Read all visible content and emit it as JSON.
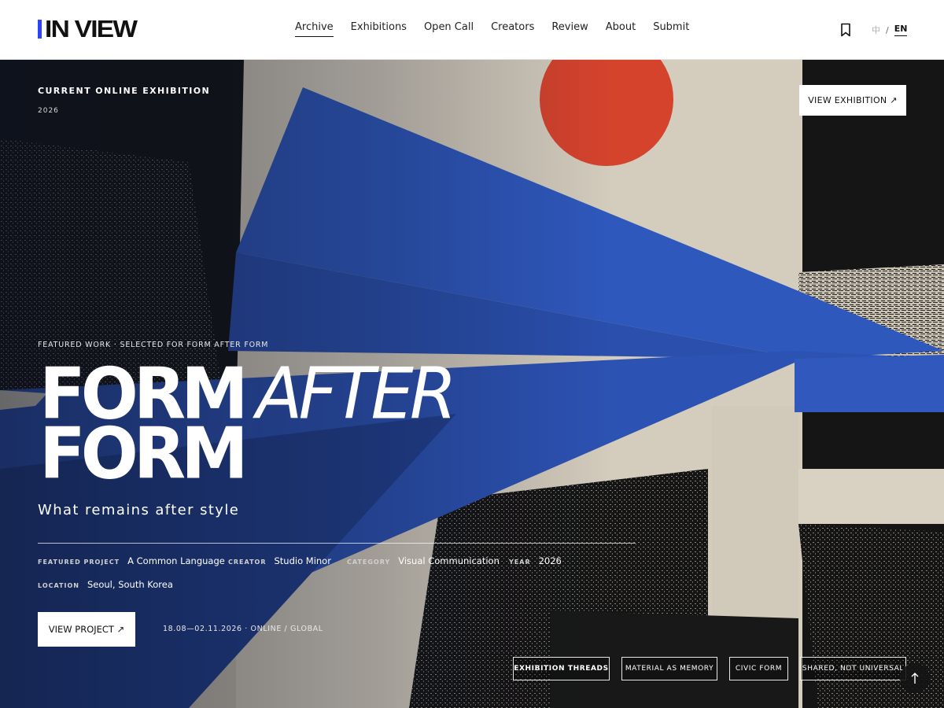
{
  "header": {
    "logo_text": "IN VIEW",
    "logo_accent_color": "#2f43ff",
    "nav": [
      {
        "label": "Archive",
        "active": true
      },
      {
        "label": "Exhibitions"
      },
      {
        "label": "Open Call"
      },
      {
        "label": "Creators"
      },
      {
        "label": "Review"
      },
      {
        "label": "About"
      },
      {
        "label": "Submit"
      }
    ],
    "bookmark_icon": "bookmark-icon",
    "lang": {
      "zh": "中",
      "sep": "/",
      "en": "EN"
    }
  },
  "hero": {
    "eyebrow": "CURRENT ONLINE EXHIBITION",
    "year": "2026",
    "view_exhibition_label": "VIEW EXHIBITION ↗",
    "featured_label": "FEATURED WORK · SELECTED FOR FORM AFTER FORM",
    "title_word1": "FORM",
    "title_word2": "AFTER",
    "title_word3": "FORM",
    "subtitle": "What remains after style",
    "meta": {
      "project_key": "FEATURED PROJECT",
      "project_val": "A Common Language",
      "creator_key": "CREATOR",
      "creator_val": "Studio Minor",
      "category_key": "CATEGORY",
      "category_val": "Visual Communication",
      "year_key": "YEAR",
      "year_val": "2026",
      "location_key": "LOCATION",
      "location_val": "Seoul, South Korea"
    },
    "view_project_label": "VIEW PROJECT ↗",
    "dates": "18.08—02.11.2026 · ONLINE / GLOBAL",
    "tags": [
      "EXHIBITION THREADS",
      "MATERIAL AS MEMORY",
      "CIVIC FORM",
      "SHARED, NOT UNIVERSAL"
    ],
    "scroll_top_icon": "arrow-up-icon",
    "colors": {
      "blue": "#2e55b8",
      "red": "#d5432d",
      "paper": "#c9c0b0"
    }
  }
}
